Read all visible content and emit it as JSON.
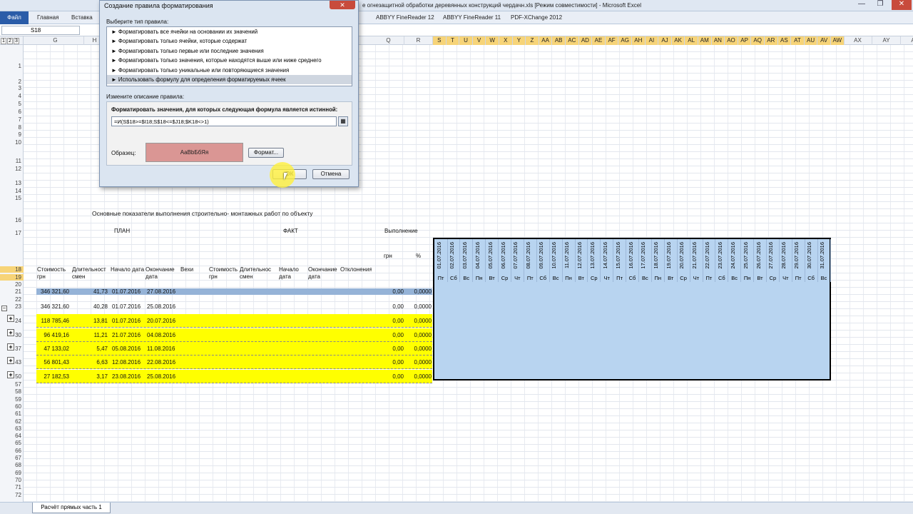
{
  "window": {
    "title": "е огнезащитной обработки деревянных конструкций чердачн.xls  [Режим совместимости] - Microsoft Excel"
  },
  "ribbon": {
    "file": "Файл",
    "tabs": [
      "Главная",
      "Вставка",
      "ABBYY FineReader 12",
      "ABBYY FineReader 11",
      "PDF-XChange 2012"
    ]
  },
  "formula_bar": {
    "cell_ref": "S18"
  },
  "outline_levels": [
    "1",
    "2",
    "3"
  ],
  "columns": {
    "left": [
      "G",
      "H"
    ],
    "mid": [
      "Q",
      "R"
    ],
    "dates": [
      "S",
      "T",
      "U",
      "V",
      "W",
      "X",
      "Y",
      "Z",
      "AA",
      "AB",
      "AC",
      "AD",
      "AE",
      "AF",
      "AG",
      "AH",
      "AI",
      "AJ",
      "AK",
      "AL",
      "AM",
      "AN",
      "AO",
      "AP",
      "AQ",
      "AR",
      "AS",
      "AT",
      "AU",
      "AV",
      "AW"
    ],
    "right": [
      "AX",
      "AY",
      "AZ"
    ]
  },
  "rows": {
    "numbers": [
      "1",
      "2",
      "3",
      "4",
      "5",
      "6",
      "7",
      "8",
      "9",
      "10",
      "11",
      "12",
      "13",
      "14",
      "15",
      "16",
      "17",
      "18",
      "19",
      "20",
      "21",
      "22",
      "23",
      "24",
      "30",
      "37",
      "43",
      "50",
      "57",
      "58",
      "59",
      "60",
      "61",
      "62",
      "63",
      "64",
      "65",
      "66",
      "67",
      "68",
      "69",
      "70",
      "71",
      "72"
    ]
  },
  "sheet": {
    "title": "Основные показатели выполнения строительно- монтажных работ по объекту",
    "plan": "ПЛАН",
    "fact": "ФАКТ",
    "execution": "Выполнение",
    "exec_cols": [
      "грн",
      "%"
    ],
    "headers_plan": [
      "Стоимость грн",
      "Длительность смен",
      "Начало дата",
      "Окончание дата",
      "Вехи"
    ],
    "headers_fact": [
      "Стоимость грн",
      "Длительность смен",
      "Начало дата",
      "Окончание дата",
      "Отклонения"
    ],
    "data_rows": [
      {
        "row": "21",
        "cost": "346 321,60",
        "dur": "41,73",
        "start": "01.07.2016",
        "end": "27.08.2016",
        "exec": "0,00",
        "pct": "0,0000"
      },
      {
        "row": "23",
        "cost": "346 321,60",
        "dur": "40,28",
        "start": "01.07.2016",
        "end": "25.08.2016",
        "exec": "0,00",
        "pct": "0,0000"
      },
      {
        "row": "24",
        "cost": "118 785,46",
        "dur": "13,81",
        "start": "01.07.2016",
        "end": "20.07.2016",
        "exec": "0,00",
        "pct": "0,0000"
      },
      {
        "row": "30",
        "cost": "96 419,16",
        "dur": "11,21",
        "start": "21.07.2016",
        "end": "04.08.2016",
        "exec": "0,00",
        "pct": "0,0000"
      },
      {
        "row": "37",
        "cost": "47 133,02",
        "dur": "5,47",
        "start": "05.08.2016",
        "end": "11.08.2016",
        "exec": "0,00",
        "pct": "0,0000"
      },
      {
        "row": "43",
        "cost": "56 801,43",
        "dur": "6,63",
        "start": "12.08.2016",
        "end": "22.08.2016",
        "exec": "0,00",
        "pct": "0,0000"
      },
      {
        "row": "50",
        "cost": "27 182,53",
        "dur": "3,17",
        "start": "23.08.2016",
        "end": "25.08.2016",
        "exec": "0,00",
        "pct": "0,0000"
      }
    ],
    "dates": [
      "01.07.2016",
      "02.07.2016",
      "03.07.2016",
      "04.07.2016",
      "05.07.2016",
      "06.07.2016",
      "07.07.2016",
      "08.07.2016",
      "09.07.2016",
      "10.07.2016",
      "11.07.2016",
      "12.07.2016",
      "13.07.2016",
      "14.07.2016",
      "15.07.2016",
      "16.07.2016",
      "17.07.2016",
      "18.07.2016",
      "19.07.2016",
      "20.07.2016",
      "21.07.2016",
      "22.07.2016",
      "23.07.2016",
      "24.07.2016",
      "25.07.2016",
      "26.07.2016",
      "27.07.2016",
      "28.07.2016",
      "29.07.2016",
      "30.07.2016",
      "31.07.2016"
    ],
    "weekdays": [
      "Пт",
      "Сб",
      "Вс",
      "Пн",
      "Вт",
      "Ср",
      "Чт",
      "Пт",
      "Сб",
      "Вс",
      "Пн",
      "Вт",
      "Ср",
      "Чт",
      "Пт",
      "Сб",
      "Вс",
      "Пн",
      "Вт",
      "Ср",
      "Чт",
      "Пт",
      "Сб",
      "Вс",
      "Пн",
      "Вт",
      "Ср",
      "Чт",
      "Пт",
      "Сб",
      "Вс"
    ]
  },
  "sheet_tab": "Расчёт прямых часть 1",
  "dialog": {
    "title": "Создание правила форматирования",
    "select_type_label": "Выберите тип правила:",
    "rule_types": [
      "► Форматировать все ячейки на основании их значений",
      "► Форматировать только ячейки, которые содержат",
      "► Форматировать только первые или последние значения",
      "► Форматировать только значения, которые находятся выше или ниже среднего",
      "► Форматировать только уникальные или повторяющиеся значения",
      "► Использовать формулу для определения форматируемых ячеек"
    ],
    "edit_desc_label": "Измените описание правила:",
    "formula_label": "Форматировать значения, для которых следующая формула является истинной:",
    "formula": "=И(S$18>=$I18;S$18<=$J18;$K18<>1)",
    "preview_label": "Образец:",
    "preview_text": "АаВbБбЯя",
    "format_button": "Формат...",
    "ok": "ОК",
    "cancel": "Отмена",
    "close": "✕"
  }
}
